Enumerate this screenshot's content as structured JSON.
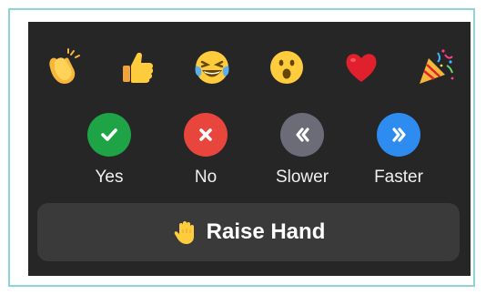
{
  "reactions": [
    {
      "name": "clapping-hands",
      "icon": "clap-icon"
    },
    {
      "name": "thumbs-up",
      "icon": "thumbs-up-icon"
    },
    {
      "name": "tears-of-joy",
      "icon": "laugh-icon"
    },
    {
      "name": "open-mouth",
      "icon": "surprised-icon"
    },
    {
      "name": "heart",
      "icon": "heart-icon"
    },
    {
      "name": "party-popper",
      "icon": "party-icon"
    }
  ],
  "feedback": [
    {
      "label": "Yes",
      "color": "#1ea446",
      "icon": "check-icon"
    },
    {
      "label": "No",
      "color": "#e8463c",
      "icon": "x-icon"
    },
    {
      "label": "Slower",
      "color": "#6c6c78",
      "icon": "rewind-icon"
    },
    {
      "label": "Faster",
      "color": "#2e8cf0",
      "icon": "fast-forward-icon"
    }
  ],
  "raise_hand": {
    "label": "Raise Hand",
    "icon": "raised-hand-icon"
  },
  "colors": {
    "panel_bg": "#262626",
    "button_bg": "#3a3a3a",
    "frame_border": "#8fd3d6"
  }
}
